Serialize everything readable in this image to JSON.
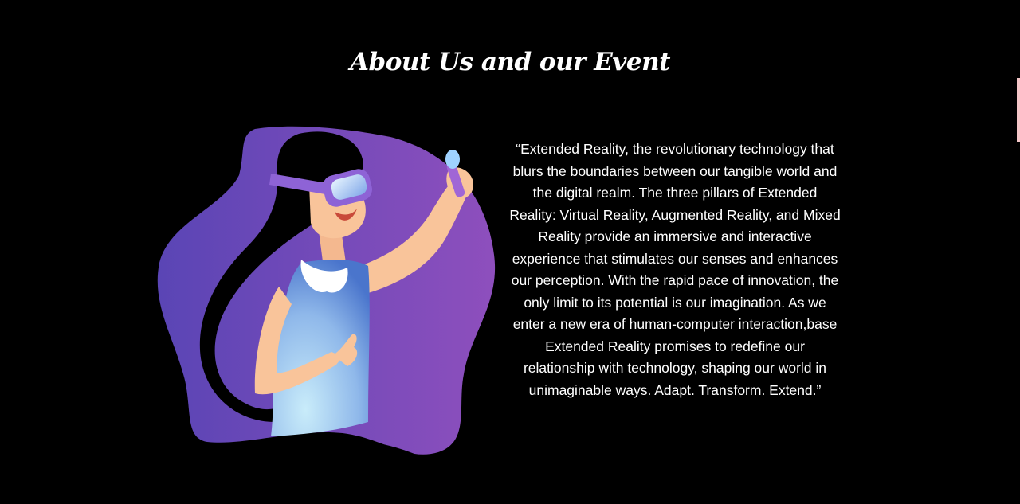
{
  "about": {
    "title": "About Us and our Event",
    "description": "“Extended Reality, the revolutionary technology that blurs the boundaries between our tangible world and the digital realm. The three pillars of Extended Reality: Virtual Reality, Augmented Reality, and Mixed Reality provide an immersive and interactive experience that stimulates our senses and enhances our perception. With the rapid pace of innovation, the only limit to its potential is our imagination. As we enter a new era of human-computer interaction,base Extended Reality promises to redefine our relationship with technology, shaping our world in unimaginable ways. Adapt. Transform. Extend.”"
  },
  "illustration": {
    "name": "woman-vr-headset-illustration",
    "colors": {
      "blob_start": "#5a45b5",
      "blob_end": "#8e4fbd",
      "hair": "#000000",
      "skin": "#f9c49a",
      "dress_light": "#c9ecfa",
      "dress_dark": "#4a75cc",
      "headset": "#8e63d6"
    }
  },
  "theme": {
    "background": "#000000",
    "text": "#ffffff",
    "edge_accent": "#f4c6c8"
  }
}
